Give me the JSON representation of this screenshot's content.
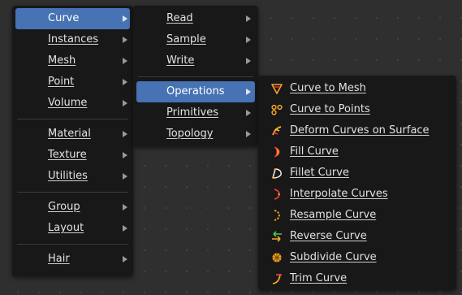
{
  "menu_main": {
    "groups": [
      [
        {
          "label": "Curve",
          "active": true
        },
        {
          "label": "Instances"
        },
        {
          "label": "Mesh"
        },
        {
          "label": "Point"
        },
        {
          "label": "Volume"
        }
      ],
      [
        {
          "label": "Material"
        },
        {
          "label": "Texture"
        },
        {
          "label": "Utilities"
        }
      ],
      [
        {
          "label": "Group"
        },
        {
          "label": "Layout"
        }
      ],
      [
        {
          "label": "Hair"
        }
      ]
    ]
  },
  "menu_curve": {
    "groups": [
      [
        {
          "label": "Read"
        },
        {
          "label": "Sample"
        },
        {
          "label": "Write"
        }
      ],
      [
        {
          "label": "Operations",
          "active": true
        },
        {
          "label": "Primitives"
        },
        {
          "label": "Topology"
        }
      ]
    ]
  },
  "menu_operations": {
    "items": [
      {
        "label": "Curve to Mesh",
        "icon": "curve-to-mesh-icon"
      },
      {
        "label": "Curve to Points",
        "icon": "curve-to-points-icon"
      },
      {
        "label": "Deform Curves on Surface",
        "icon": "deform-curves-icon"
      },
      {
        "label": "Fill Curve",
        "icon": "fill-curve-icon"
      },
      {
        "label": "Fillet Curve",
        "icon": "fillet-curve-icon"
      },
      {
        "label": "Interpolate Curves",
        "icon": "interpolate-curves-icon"
      },
      {
        "label": "Resample Curve",
        "icon": "resample-curve-icon"
      },
      {
        "label": "Reverse Curve",
        "icon": "reverse-curve-icon"
      },
      {
        "label": "Subdivide Curve",
        "icon": "subdivide-curve-icon"
      },
      {
        "label": "Trim Curve",
        "icon": "trim-curve-icon"
      }
    ]
  },
  "colors": {
    "menu_bg": "#181818",
    "highlight": "#4772b3",
    "icon_orange": "#f5a623",
    "icon_red": "#e53b3b",
    "icon_green": "#4cc94c"
  }
}
